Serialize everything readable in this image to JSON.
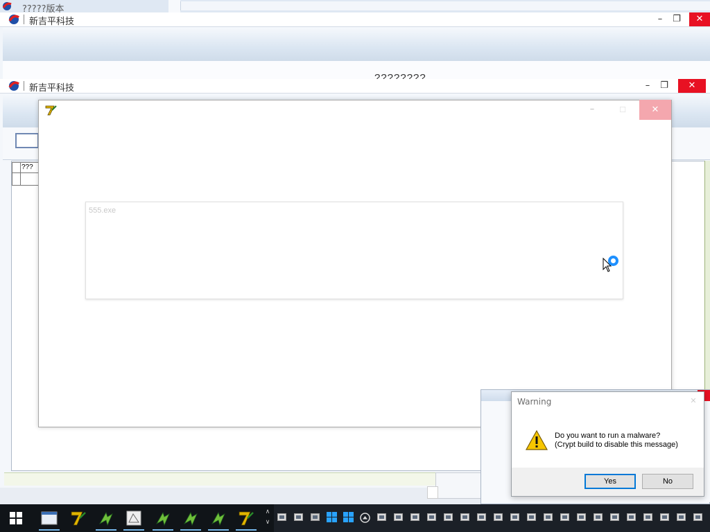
{
  "top_tab": {
    "title": "?????版本"
  },
  "window1": {
    "title": "新吉平科技",
    "partial_text": "????????",
    "minimize": "–",
    "restore": "❐",
    "close": "✕"
  },
  "window2": {
    "title": "新吉平科技",
    "minimize": "–",
    "restore": "❐",
    "close": "✕",
    "grid_header": "???",
    "bottom_label": "?????????"
  },
  "loader": {
    "drop_text": "555.exe",
    "minimize": "–",
    "maximize": "☐",
    "close": "✕"
  },
  "warning_dialog": {
    "title": "Warning",
    "close": "✕",
    "message_line1": "Do you want to run a malware?",
    "message_line2": "(Crypt build to disable this message)",
    "yes_label": "Yes",
    "no_label": "No"
  },
  "taskbar": {
    "scroll_up": "∧",
    "scroll_down": "∨"
  },
  "colors": {
    "accent": "#0078d7",
    "close_red": "#e81123",
    "taskbar": "#101418"
  }
}
